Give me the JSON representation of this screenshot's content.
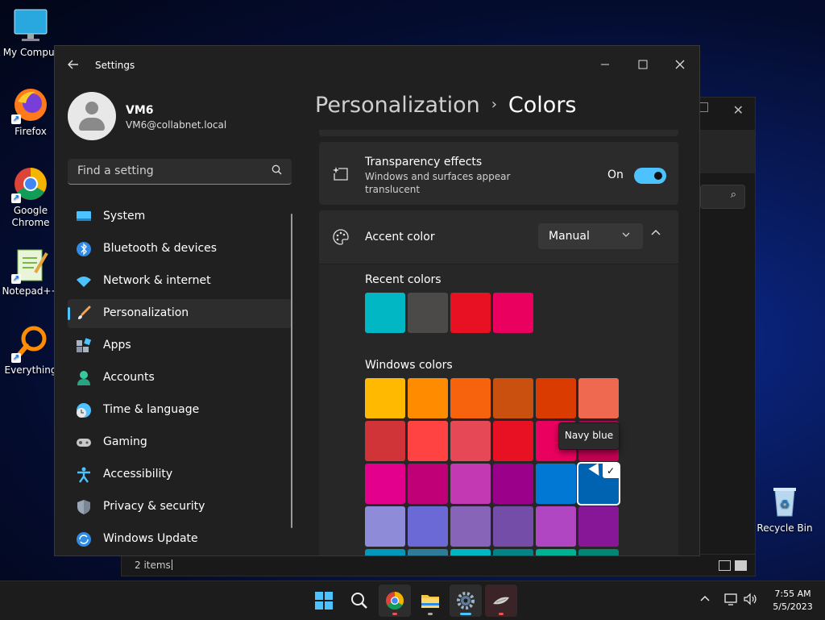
{
  "desktop": {
    "icons": [
      {
        "label": "My Comput"
      },
      {
        "label": "Firefox"
      },
      {
        "label": "Google Chrome"
      },
      {
        "label": "Notepad++"
      },
      {
        "label": "Everything"
      },
      {
        "label": "Recycle Bin"
      }
    ]
  },
  "background_window": {
    "status_count": "2 items",
    "status_sep": "|"
  },
  "settings": {
    "app_title": "Settings",
    "user": {
      "name": "VM6",
      "email": "VM6@collabnet.local"
    },
    "search_placeholder": "Find a setting",
    "nav": [
      {
        "label": "System",
        "icon": "system-icon",
        "color": "#4cc2ff"
      },
      {
        "label": "Bluetooth & devices",
        "icon": "bluetooth-icon",
        "color": "#2f8be6"
      },
      {
        "label": "Network & internet",
        "icon": "wifi-icon",
        "color": "#4cc2ff"
      },
      {
        "label": "Personalization",
        "icon": "paintbrush-icon",
        "color": "#f2a35a",
        "active": true
      },
      {
        "label": "Apps",
        "icon": "apps-icon",
        "color": "#a9b4c2"
      },
      {
        "label": "Accounts",
        "icon": "accounts-icon",
        "color": "#38c9a0"
      },
      {
        "label": "Time & language",
        "icon": "clock-globe-icon",
        "color": "#4cc2ff"
      },
      {
        "label": "Gaming",
        "icon": "gamepad-icon",
        "color": "#c8c8c8"
      },
      {
        "label": "Accessibility",
        "icon": "accessibility-icon",
        "color": "#4cc2ff"
      },
      {
        "label": "Privacy & security",
        "icon": "shield-icon",
        "color": "#9aa6b3"
      },
      {
        "label": "Windows Update",
        "icon": "update-icon",
        "color": "#2f8be6"
      }
    ],
    "breadcrumb": {
      "parent": "Personalization",
      "separator": "›",
      "current": "Colors"
    },
    "transparency": {
      "title": "Transparency effects",
      "description": "Windows and surfaces appear translucent",
      "state_label": "On",
      "enabled": true
    },
    "accent": {
      "title": "Accent color",
      "mode": "Manual",
      "recent_title": "Recent colors",
      "recent_colors": [
        "#00b7c3",
        "#4c4a48",
        "#e81123",
        "#ea005e"
      ],
      "windows_title": "Windows colors",
      "windows_colors": [
        [
          "#ffb900",
          "#ff8c00",
          "#f7630c",
          "#ca5010",
          "#da3b01",
          "#ef6950"
        ],
        [
          "#d13438",
          "#ff4343",
          "#e74856",
          "#e81123",
          "#ea005e",
          "#c30052"
        ],
        [
          "#e3008c",
          "#bf0077",
          "#c239b3",
          "#9a0089",
          "#0078d4",
          "#0063b1"
        ],
        [
          "#8e8cd8",
          "#6b69d6",
          "#8764b8",
          "#744da9",
          "#b146c2",
          "#881798"
        ],
        [
          "#0099bc",
          "#2d7d9a",
          "#00b7c3",
          "#038387",
          "#00b294",
          "#018574"
        ]
      ],
      "selected_name": "Navy blue",
      "check_glyph": "✓"
    }
  },
  "taskbar": {
    "apps": [
      "start-icon",
      "search-icon",
      "chrome-icon",
      "file-explorer-icon",
      "settings-gear-icon",
      "misc-app-icon"
    ],
    "time": "7:55 AM",
    "date": "5/5/2023"
  }
}
